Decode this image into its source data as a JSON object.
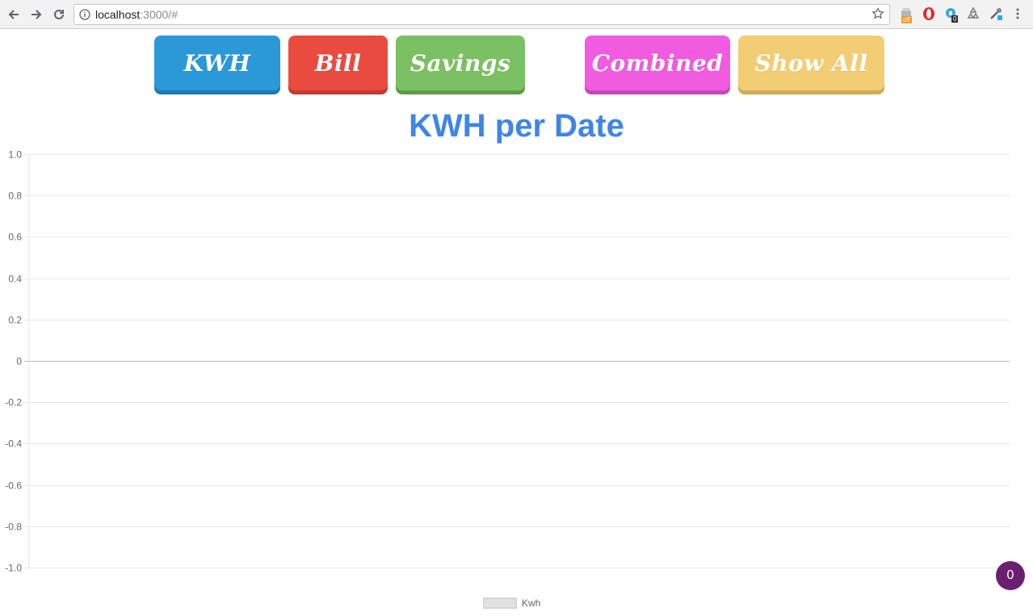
{
  "browser": {
    "url_host": "localhost",
    "url_rest": ":3000/#",
    "ext_badges": [
      "off",
      "0"
    ]
  },
  "buttons": {
    "kwh": "KWH",
    "bill": "Bill",
    "savings": "Savings",
    "combined": "Combined",
    "show_all": "Show All"
  },
  "chart_title": "KWH per Date",
  "chart_data": {
    "type": "bar",
    "title": "KWH per Date",
    "categories": [],
    "series": [
      {
        "name": "Kwh",
        "values": []
      }
    ],
    "ylim": [
      -1.0,
      1.0
    ],
    "yticks": [
      "1.0",
      "0.8",
      "0.6",
      "0.4",
      "0.2",
      "0",
      "-0.2",
      "-0.4",
      "-0.6",
      "-0.8",
      "-1.0"
    ],
    "grid": true,
    "legend": "bottom"
  },
  "legend_label": "Kwh",
  "fab_count": "0",
  "colors": {
    "kwh": "#2b98d8",
    "bill": "#ea4b3f",
    "savings": "#7bc062",
    "combined": "#f05be0",
    "show_all": "#f2cd73",
    "title": "#3f86e4"
  }
}
